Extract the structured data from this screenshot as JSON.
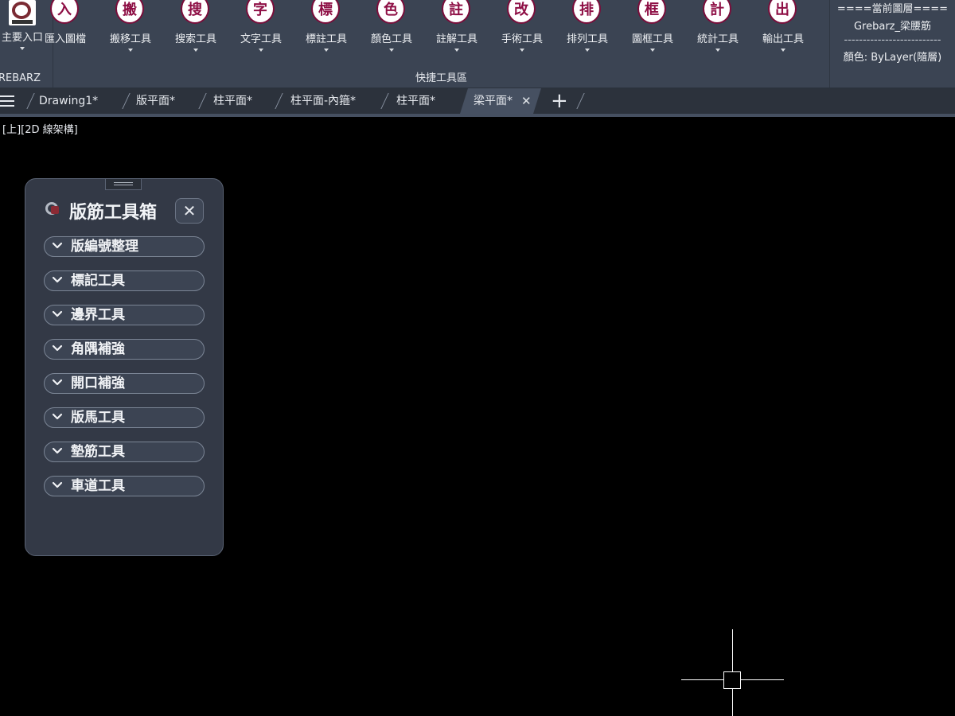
{
  "ribbon": {
    "main_group": {
      "label": "REBARZ",
      "tool_label": "主要入口",
      "icon": "grebarz-logo-icon"
    },
    "quick_group": {
      "label": "快捷工具區",
      "tools": [
        {
          "glyph": "入",
          "label": "匯入圖檔",
          "has_dropdown": false
        },
        {
          "glyph": "搬",
          "label": "搬移工具",
          "has_dropdown": true
        },
        {
          "glyph": "搜",
          "label": "搜索工具",
          "has_dropdown": true
        },
        {
          "glyph": "字",
          "label": "文字工具",
          "has_dropdown": true
        },
        {
          "glyph": "標",
          "label": "標註工具",
          "has_dropdown": true
        },
        {
          "glyph": "色",
          "label": "顏色工具",
          "has_dropdown": true
        },
        {
          "glyph": "註",
          "label": "註解工具",
          "has_dropdown": true
        },
        {
          "glyph": "改",
          "label": "手術工具",
          "has_dropdown": true
        },
        {
          "glyph": "排",
          "label": "排列工具",
          "has_dropdown": true
        },
        {
          "glyph": "框",
          "label": "圖框工具",
          "has_dropdown": true
        },
        {
          "glyph": "計",
          "label": "統計工具",
          "has_dropdown": true
        },
        {
          "glyph": "出",
          "label": "輸出工具",
          "has_dropdown": true
        }
      ]
    },
    "layer_group": {
      "header": "====當前圖層====",
      "layer_name": "Grebarz_梁腰筋",
      "divider": "--------------------------",
      "color_text": "顏色: ByLayer(隨層)"
    }
  },
  "tabs": {
    "items": [
      {
        "label": "Drawing1*",
        "active": false
      },
      {
        "label": "版平面*",
        "active": false
      },
      {
        "label": "柱平面*",
        "active": false
      },
      {
        "label": "柱平面-內箍*",
        "active": false
      },
      {
        "label": "柱平面*",
        "active": false
      },
      {
        "label": "梁平面*",
        "active": true
      }
    ],
    "close_symbol": "✕",
    "add_symbol": "+"
  },
  "viewport": {
    "label": "[上][2D 線架構]"
  },
  "panel": {
    "title": "版筋工具箱",
    "close_symbol": "✕",
    "sections": [
      "版編號整理",
      "標記工具",
      "邊界工具",
      "角隅補強",
      "開口補強",
      "版馬工具",
      "墊筋工具",
      "車道工具"
    ]
  },
  "colors": {
    "ribbon_bg": "#3b4453",
    "tab_active": "#465061",
    "panel_bg": "#333946",
    "icon_accent": "#8e0f45",
    "canvas_bg": "#000000"
  }
}
